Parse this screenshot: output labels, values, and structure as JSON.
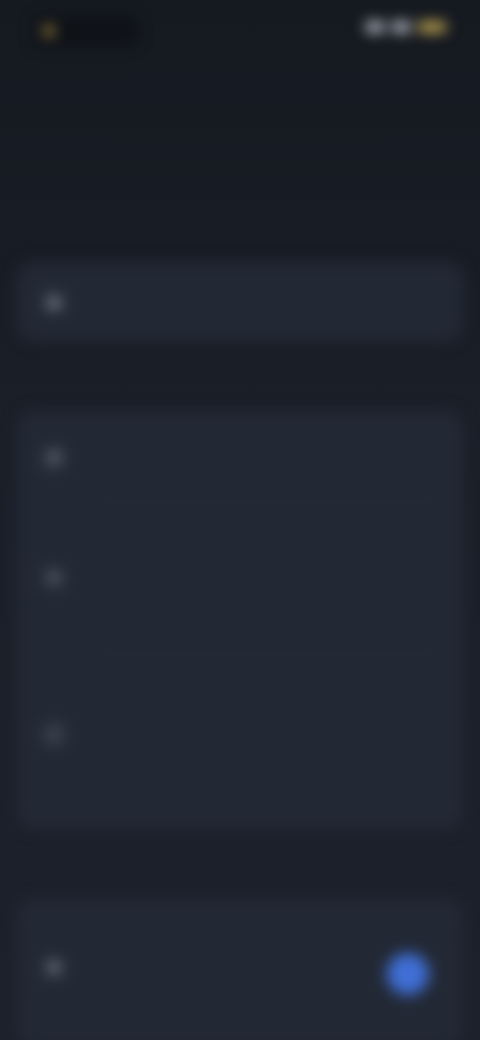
{
  "status_bar": {
    "time": "",
    "icons": [
      "signal-icon",
      "wifi-icon",
      "battery-icon"
    ],
    "accent": "#d9b24a"
  },
  "header": {
    "title": ""
  },
  "page": {
    "title": "",
    "subtitle": ""
  },
  "primary_card": {
    "icon": "shield-icon",
    "label": ""
  },
  "sections": [
    {
      "label": "",
      "items": [
        {
          "icon": "settings-icon",
          "title": "",
          "description": ""
        },
        {
          "icon": "lock-icon",
          "title": "",
          "description": ""
        },
        {
          "icon": "info-icon",
          "title": "",
          "description": ""
        }
      ]
    },
    {
      "label": "",
      "items": [
        {
          "icon": "toggle-icon",
          "title": "",
          "description": "",
          "toggle_on": true
        }
      ]
    }
  ],
  "colors": {
    "background": "#151a22",
    "card": "#222834",
    "accent": "#3f6fd6"
  }
}
